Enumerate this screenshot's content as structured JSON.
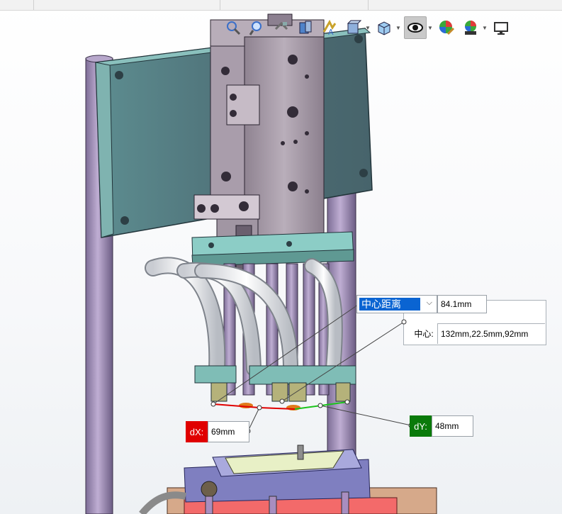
{
  "toolbar": {
    "icons": [
      "zoom-fit-icon",
      "zoom-area-icon",
      "previous-view-icon",
      "section-view-icon",
      "dynamic-annotation-icon",
      "view-orientation-icon",
      "display-style-icon",
      "hide-show-items-icon",
      "edit-appearance-icon",
      "apply-scene-icon",
      "view-settings-icon"
    ],
    "active": "hide-show-items-icon"
  },
  "measure": {
    "mode_value": "中心距离",
    "distance_value": "84.1mm",
    "center_label": "中心:",
    "center_value": "132mm,22.5mm,92mm",
    "dx_label": "dX:",
    "dx_value": "69mm",
    "dy_label": "dY:",
    "dy_value": "48mm"
  },
  "colors": {
    "plate": "#6f9fa0",
    "plate_dark": "#4f6f75",
    "cylinder": "#a89aa6",
    "rod": "#9d8ab3",
    "dx_red": "#e00000",
    "dy_green": "#0a7a0a",
    "select_blue": "#0a64d2"
  }
}
